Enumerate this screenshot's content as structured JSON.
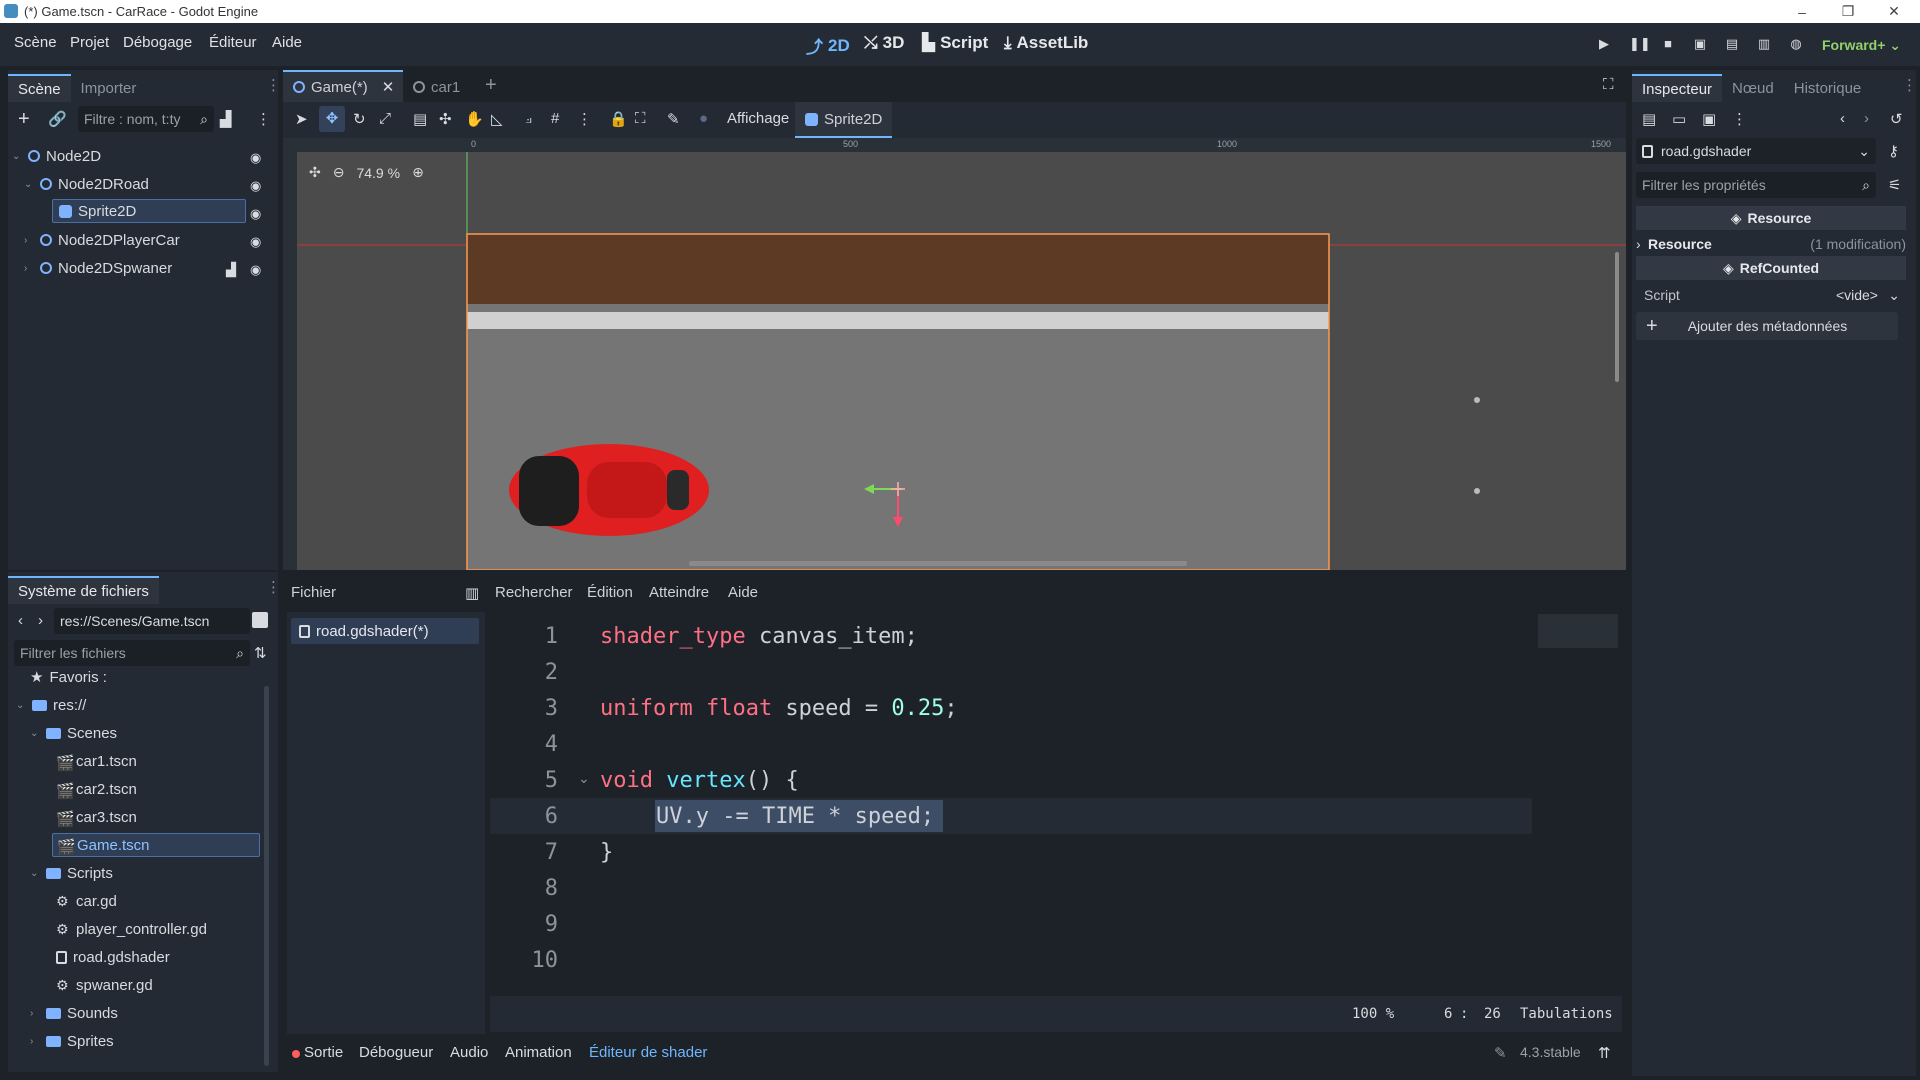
{
  "window": {
    "title": "(*) Game.tscn - CarRace - Godot Engine"
  },
  "menu": [
    "Scène",
    "Projet",
    "Débogage",
    "Éditeur",
    "Aide"
  ],
  "modes": {
    "m2d": "2D",
    "m3d": "3D",
    "script": "Script",
    "assetlib": "AssetLib"
  },
  "renderer": "Forward+",
  "scene_dock": {
    "tabs": [
      "Scène",
      "Importer"
    ],
    "filter_placeholder": "Filtre : nom, t:ty",
    "nodes": [
      {
        "label": "Node2D"
      },
      {
        "label": "Node2DRoad"
      },
      {
        "label": "Sprite2D"
      },
      {
        "label": "Node2DPlayerCar"
      },
      {
        "label": "Node2DSpwaner"
      }
    ]
  },
  "editor_tabs": [
    "Game(*)",
    "car1"
  ],
  "viewport_toolbar": {
    "affichage": "Affichage",
    "sprite": "Sprite2D"
  },
  "viewport": {
    "zoom": "74.9 %",
    "ruler": [
      "0",
      "500",
      "1000",
      "1500"
    ]
  },
  "filesystem": {
    "title": "Système de fichiers",
    "path": "res://Scenes/Game.tscn",
    "filter_placeholder": "Filtrer les fichiers",
    "items": [
      {
        "label": "Favoris :"
      },
      {
        "label": "res://"
      },
      {
        "label": "Scenes"
      },
      {
        "label": "car1.tscn"
      },
      {
        "label": "car2.tscn"
      },
      {
        "label": "car3.tscn"
      },
      {
        "label": "Game.tscn"
      },
      {
        "label": "Scripts"
      },
      {
        "label": "car.gd"
      },
      {
        "label": "player_controller.gd"
      },
      {
        "label": "road.gdshader"
      },
      {
        "label": "spwaner.gd"
      },
      {
        "label": "Sounds"
      },
      {
        "label": "Sprites"
      }
    ]
  },
  "shader_editor": {
    "menu": [
      "Fichier",
      "Rechercher",
      "Édition",
      "Atteindre",
      "Aide"
    ],
    "file": "road.gdshader(*)",
    "line_numbers": [
      "1",
      "2",
      "3",
      "4",
      "5",
      "6",
      "7",
      "8",
      "9",
      "10"
    ],
    "lines": {
      "l1a": "shader_type",
      "l1b": " canvas_item;",
      "l3a": "uniform float",
      "l3b": " speed = ",
      "l3c": "0.25",
      "l3d": ";",
      "l5a": "void",
      "l5b": " vertex",
      "l5c": "() {",
      "l6": "UV.y -= TIME * speed;",
      "l7": "}"
    },
    "status": {
      "zoom": "100 %",
      "line": "6",
      "col": "26",
      "indent": "Tabulations"
    }
  },
  "bottom_panel": {
    "tabs": [
      "Sortie",
      "Débogueur",
      "Audio",
      "Animation",
      "Éditeur de shader"
    ],
    "version": "4.3.stable"
  },
  "inspector": {
    "tabs": [
      "Inspecteur",
      "Nœud",
      "Historique"
    ],
    "resource": "road.gdshader",
    "filter_placeholder": "Filtrer les propriétés",
    "section1": "Resource",
    "resource_row": "Resource",
    "resource_note": "(1 modification)",
    "section2": "RefCounted",
    "script_label": "Script",
    "script_value": "<vide>",
    "add_meta": "Ajouter des métadonnées"
  },
  "colors": {
    "accent": "#6fb6ff",
    "road_brown": "#5c3a24",
    "car_red": "#e02020"
  }
}
